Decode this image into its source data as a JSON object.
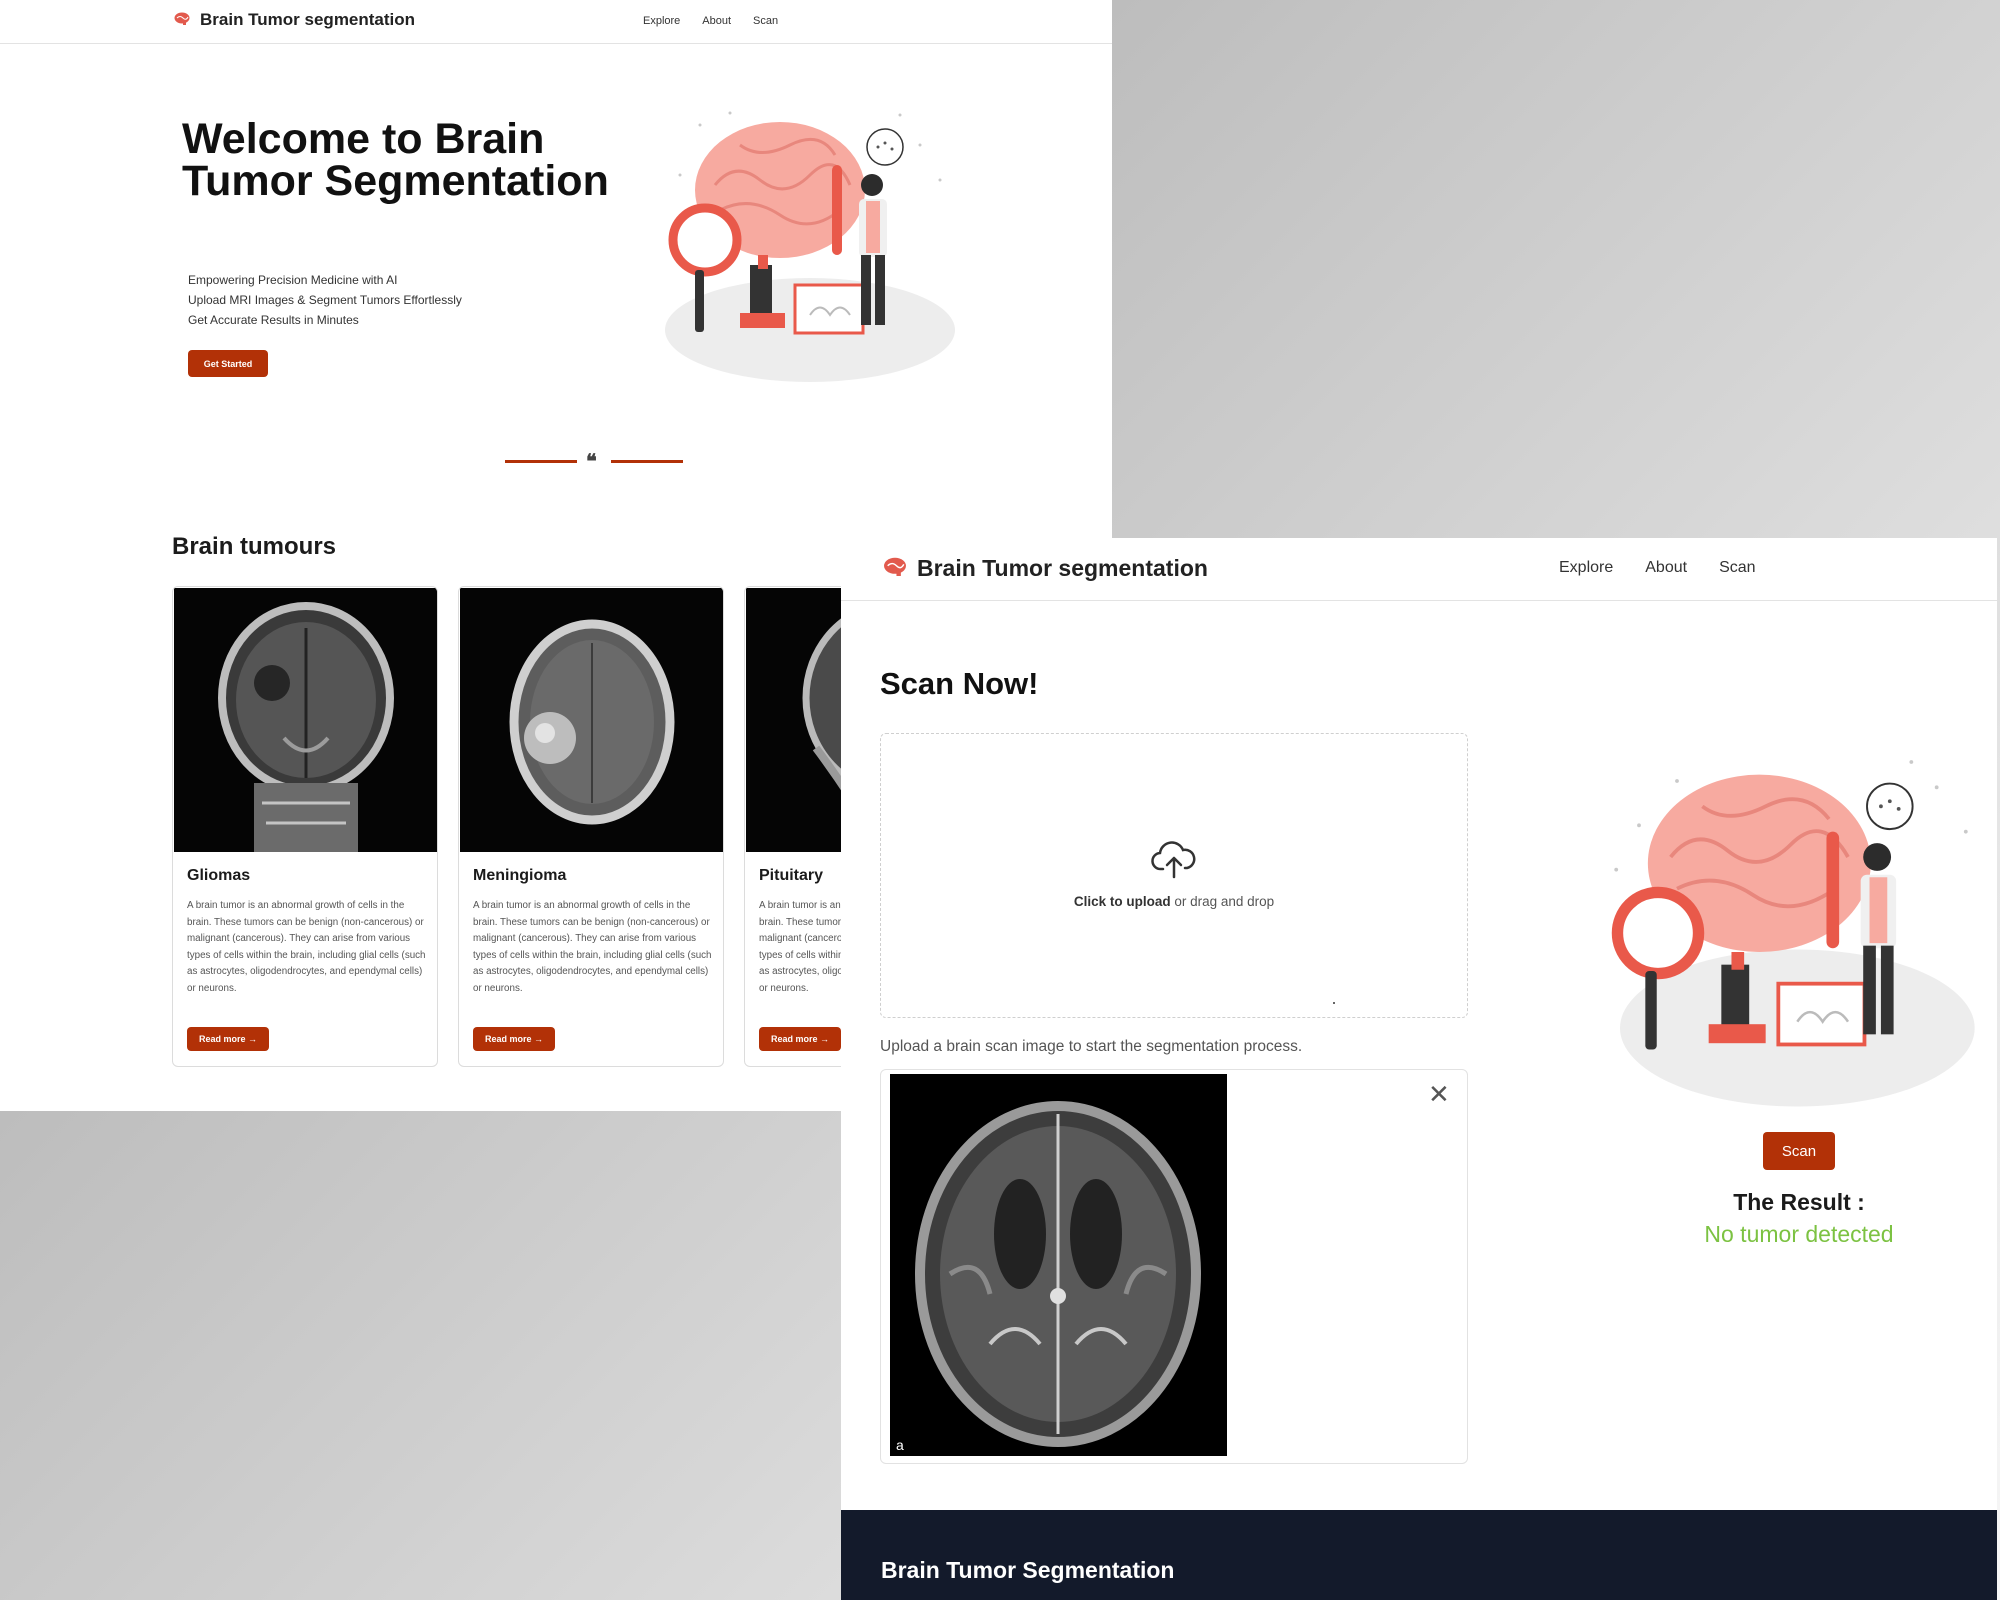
{
  "brand": {
    "name": "Brain Tumor segmentation",
    "icon": "brain-icon",
    "accent": "#b23107"
  },
  "nav": {
    "items": [
      "Explore",
      "About",
      "Scan"
    ]
  },
  "hero": {
    "title": "Welcome to Brain Tumor Segmentation",
    "lines": [
      "Empowering Precision Medicine with AI",
      "Upload MRI Images & Segment Tumors Effortlessly",
      "Get Accurate Results in Minutes"
    ],
    "cta_label": "Get Started"
  },
  "tumours": {
    "title": "Brain tumours",
    "cards": [
      {
        "title": "Gliomas",
        "description": "A brain tumor is an abnormal growth of cells in the brain. These tumors can be benign (non-cancerous) or malignant (cancerous). They can arise from various types of cells within the brain, including glial cells (such as astrocytes, oligodendrocytes, and ependymal cells) or neurons.",
        "button_label": "Read more →"
      },
      {
        "title": "Meningioma",
        "description": "A brain tumor is an abnormal growth of cells in the brain. These tumors can be benign (non-cancerous) or malignant (cancerous). They can arise from various types of cells within the brain, including glial cells (such as astrocytes, oligodendrocytes, and ependymal cells) or neurons.",
        "button_label": "Read more →"
      },
      {
        "title": "Pituitary",
        "description": "A brain tumor is an abnormal growth of cells in the brain. These tumors can be benign (non-cancerous) or malignant (cancerous). They can arise from various types of cells within the brain, including glial cells (such as astrocytes, oligodendrocytes, and ependymal cells) or neurons.",
        "button_label": "Read more →"
      }
    ]
  },
  "scan": {
    "title": "Scan Now!",
    "upload_strong": "Click to upload",
    "upload_rest": " or drag and drop",
    "hint": "Upload a brain scan image to start the segmentation process.",
    "preview_label": "a",
    "button_label": "Scan",
    "result_label": "The Result :",
    "result_value": "No tumor detected",
    "result_color": "#7cc242"
  },
  "footer": {
    "title": "Brain Tumor Segmentation",
    "background": "#131a2b"
  }
}
